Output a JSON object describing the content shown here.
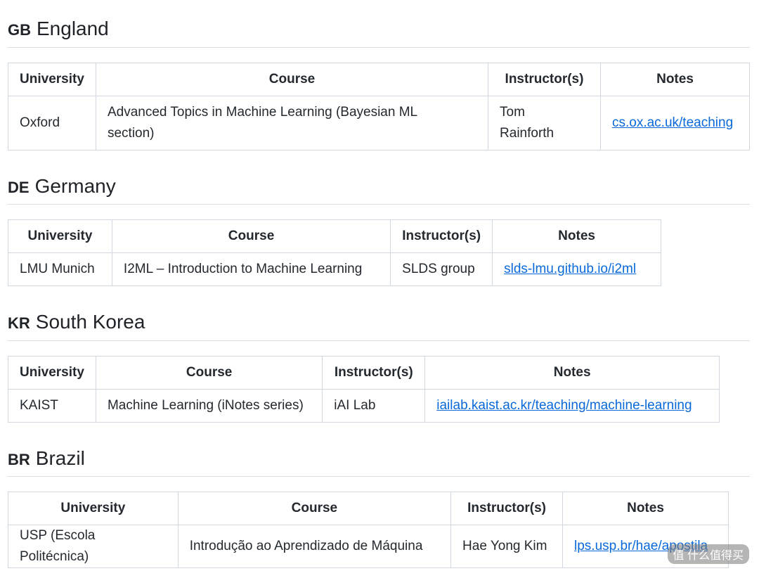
{
  "headers": {
    "university": "University",
    "course": "Course",
    "instructors": "Instructor(s)",
    "notes": "Notes"
  },
  "sections": [
    {
      "code": "GB",
      "name": "England",
      "university": "Oxford",
      "course": "Advanced Topics in Machine Learning (Bayesian ML section)",
      "instructors": "Tom Rainforth",
      "notes": "cs.ox.ac.uk/teaching"
    },
    {
      "code": "DE",
      "name": "Germany",
      "university": "LMU Munich",
      "course": "I2ML – Introduction to Machine Learning",
      "instructors": "SLDS group",
      "notes": "slds-lmu.github.io/i2ml"
    },
    {
      "code": "KR",
      "name": "South Korea",
      "university": "KAIST",
      "course": "Machine Learning (iNotes series)",
      "instructors": "iAI Lab",
      "notes": "iailab.kaist.ac.kr/teaching/machine-learning"
    },
    {
      "code": "BR",
      "name": "Brazil",
      "university": "USP (Escola Politécnica)",
      "course": "Introdução ao Aprendizado de Máquina",
      "instructors": "Hae Yong Kim",
      "notes": "lps.usp.br/hae/apostila"
    }
  ],
  "watermark": "值 什么值得买"
}
